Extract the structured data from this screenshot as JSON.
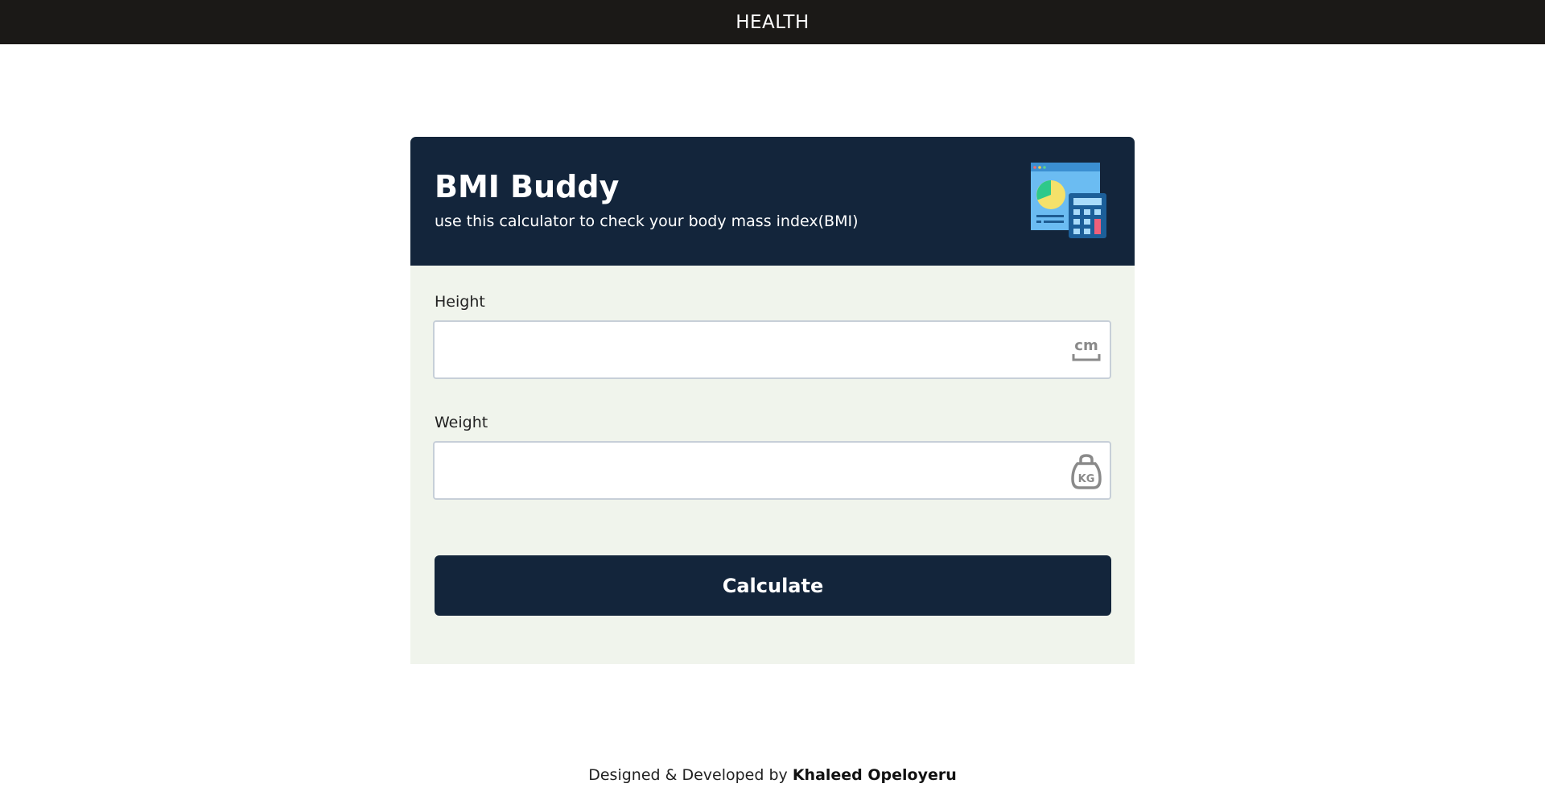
{
  "topbar": {
    "title": "HEALTH"
  },
  "card": {
    "title": "BMI Buddy",
    "subtitle": "use this calculator to check your body mass index(BMI)",
    "illustration_icon": "calculator-chart-illustration-icon"
  },
  "form": {
    "height": {
      "label": "Height",
      "value": "",
      "unit_icon": "cm-ruler-icon",
      "unit_text": "cm"
    },
    "weight": {
      "label": "Weight",
      "value": "",
      "unit_icon": "kg-weight-icon",
      "unit_text": "KG"
    },
    "submit_label": "Calculate"
  },
  "footer": {
    "prefix": "Designed & Developed by",
    "author": "Khaleed Opeloyeru"
  },
  "colors": {
    "topbar_bg": "#1b1917",
    "header_bg": "#13253b",
    "card_body_bg": "#f0f4ec",
    "button_bg": "#13253b",
    "input_border": "#c7cfd8"
  }
}
